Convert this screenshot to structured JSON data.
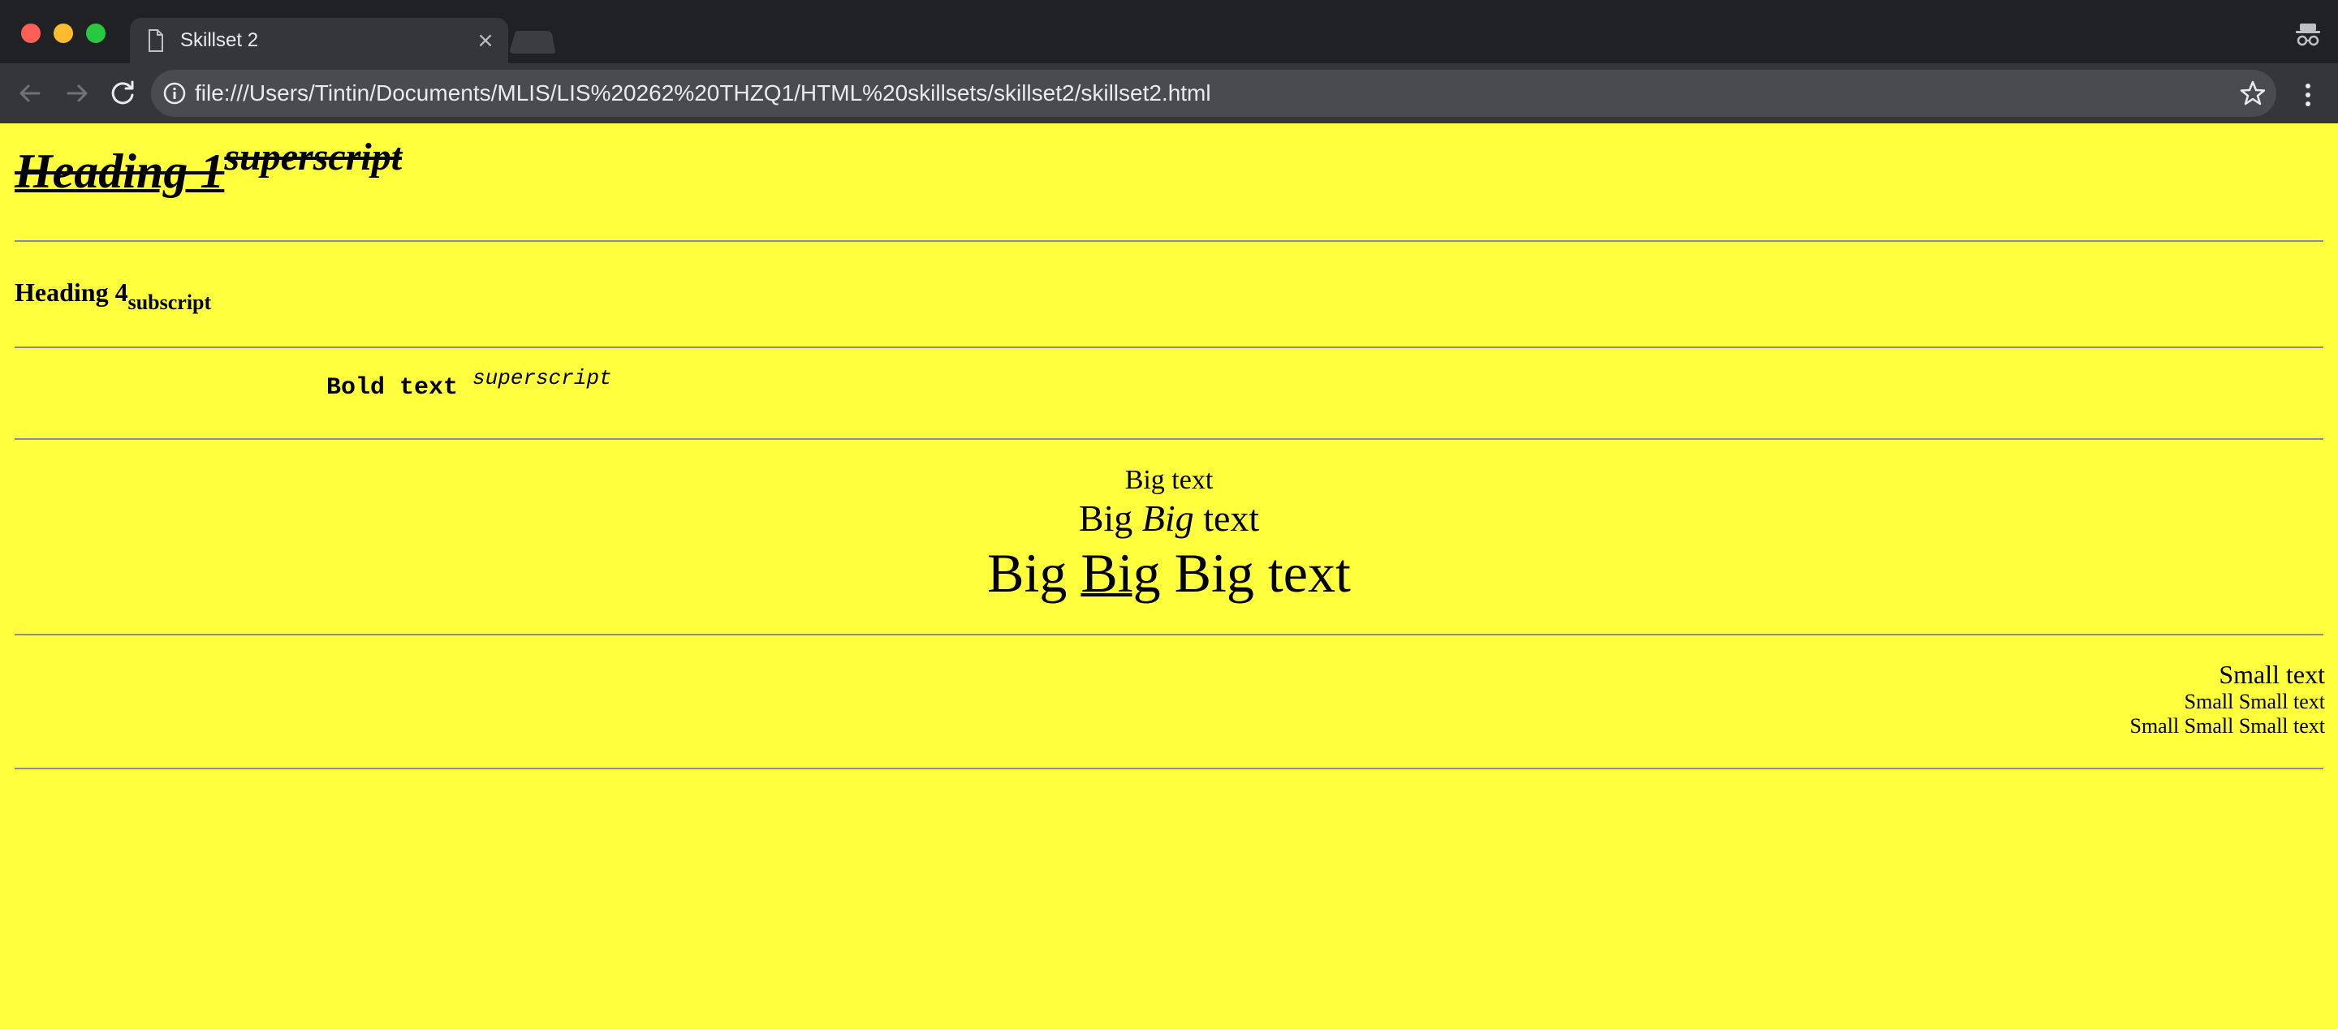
{
  "browser": {
    "tab_title": "Skillset 2",
    "tab_close_glyph": "×",
    "url": "file:///Users/Tintin/Documents/MLIS/LIS%20262%20THZQ1/HTML%20skillsets/skillset2/skillset2.html",
    "icons": [
      "back-arrow-icon",
      "forward-arrow-icon",
      "reload-icon",
      "info-icon",
      "star-icon",
      "kebab-menu-icon",
      "incognito-icon",
      "document-icon"
    ]
  },
  "page": {
    "background_color": "#ffff3d",
    "rule_color": "#8a8aa8",
    "heading1": {
      "main": "Heading 1",
      "sup": "superscript"
    },
    "heading4": {
      "main": "Heading 4",
      "sub": "subscript"
    },
    "mono_line": {
      "bold": "Bold text",
      "sup": "superscript"
    },
    "big_block": {
      "line1": "Big text",
      "line2_a": "Big ",
      "line2_em": "Big",
      "line2_b": " text",
      "line3_a": "Big ",
      "line3_ul": "Big",
      "line3_b": " Big text"
    },
    "small_block": {
      "line1": "Small text",
      "line2": "Small Small text",
      "line3": "Small Small Small text"
    }
  }
}
